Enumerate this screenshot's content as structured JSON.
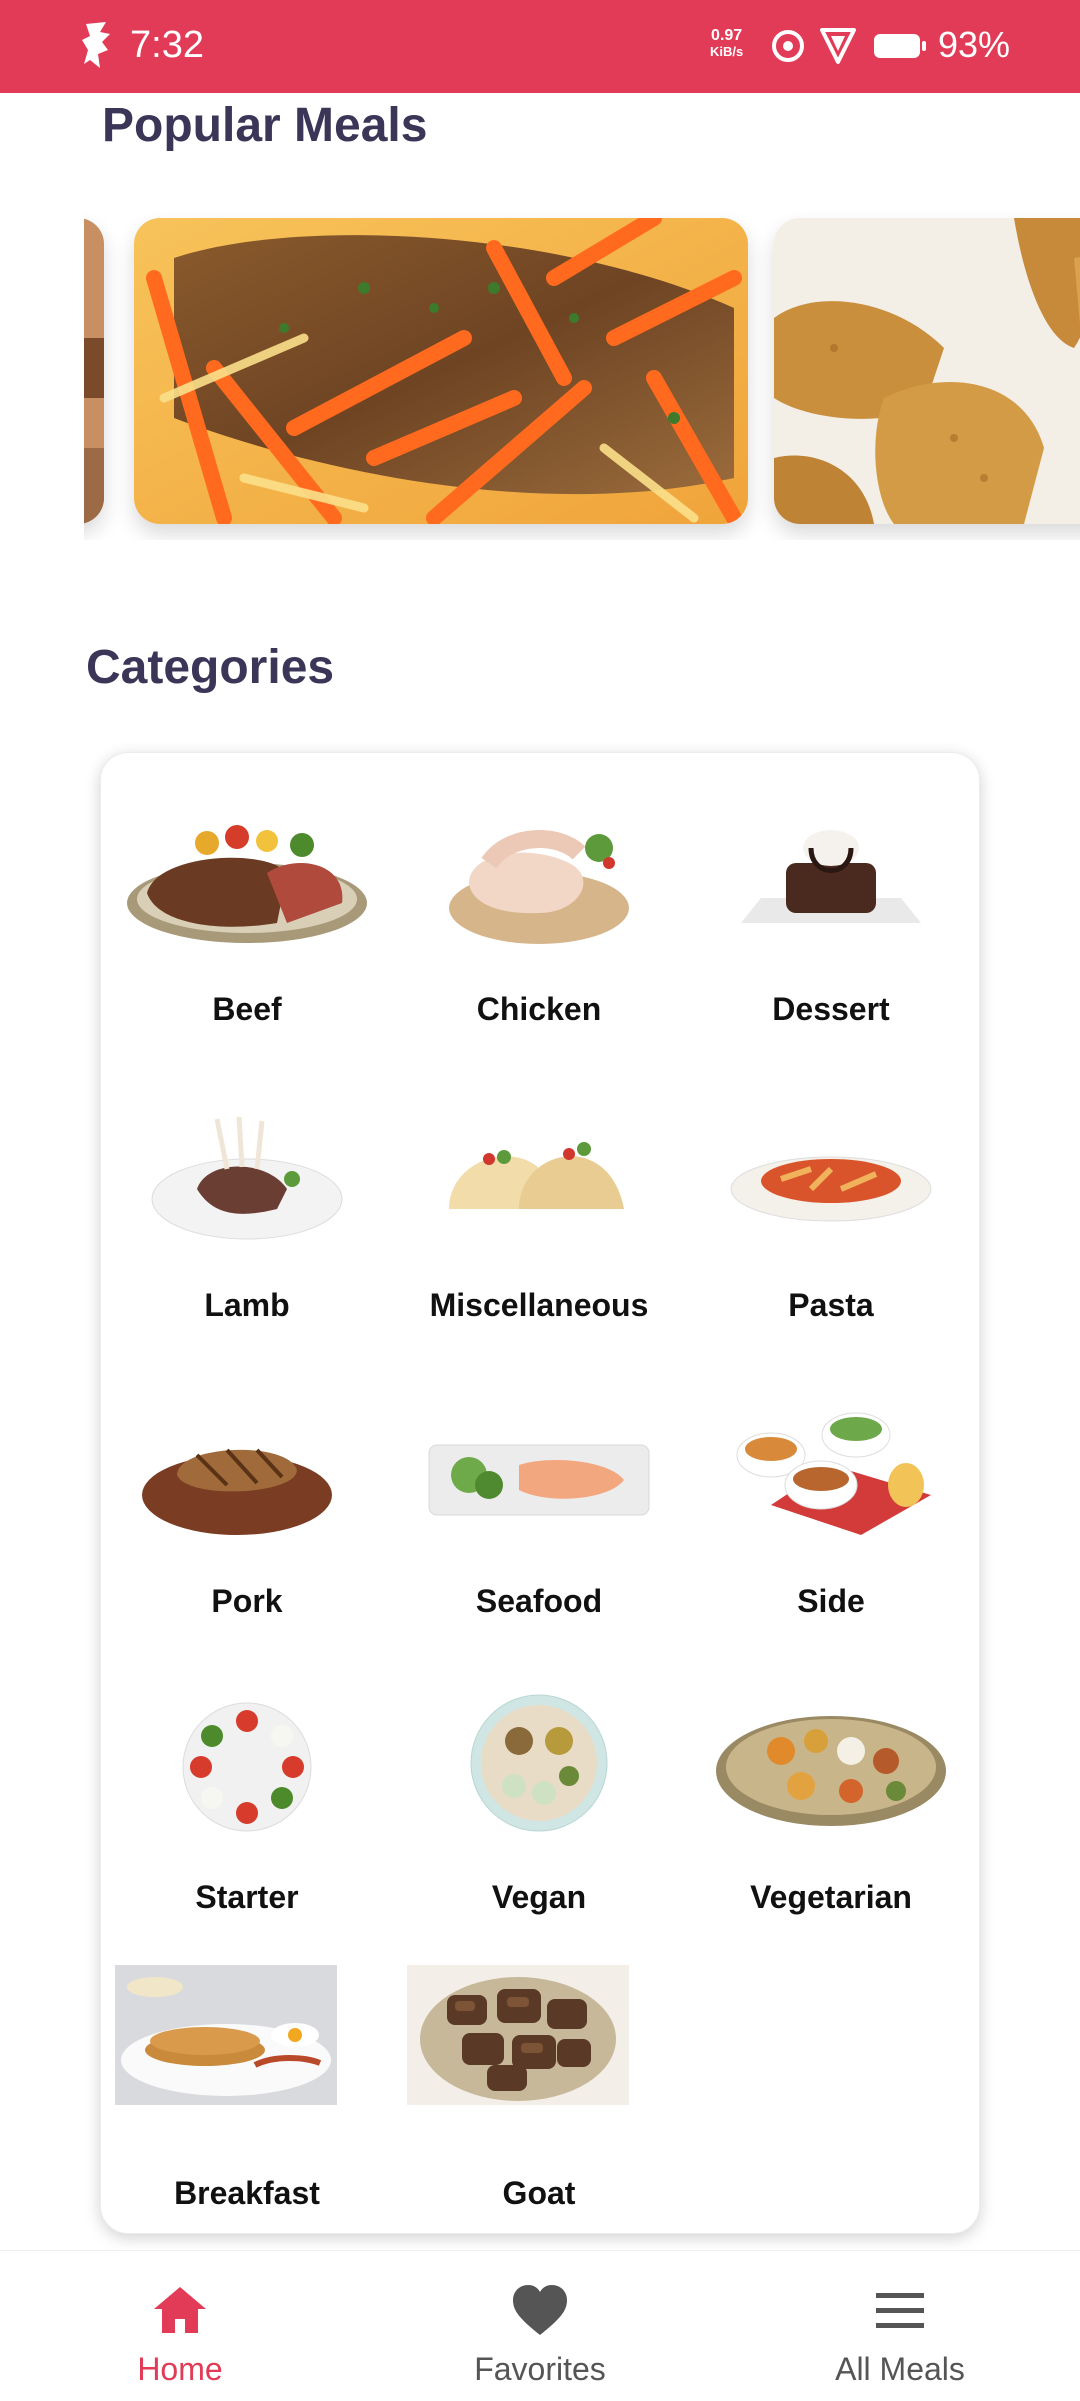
{
  "status_bar": {
    "time": "7:32",
    "speed_value": "0.97",
    "speed_unit": "KiB/s",
    "battery": "93%",
    "icons": [
      "app-logo-icon",
      "data-saver-icon",
      "vpn-icon",
      "battery-icon"
    ]
  },
  "popular": {
    "title": "Popular Meals"
  },
  "categories": {
    "title": "Categories",
    "items": [
      {
        "label": "Beef"
      },
      {
        "label": "Chicken"
      },
      {
        "label": "Dessert"
      },
      {
        "label": "Lamb"
      },
      {
        "label": "Miscellaneous"
      },
      {
        "label": "Pasta"
      },
      {
        "label": "Pork"
      },
      {
        "label": "Seafood"
      },
      {
        "label": "Side"
      },
      {
        "label": "Starter"
      },
      {
        "label": "Vegan"
      },
      {
        "label": "Vegetarian"
      },
      {
        "label": "Breakfast"
      },
      {
        "label": "Goat"
      }
    ]
  },
  "bottom_nav": {
    "items": [
      {
        "label": "Home",
        "icon": "home-icon",
        "active": true
      },
      {
        "label": "Favorites",
        "icon": "heart-icon",
        "active": false
      },
      {
        "label": "All Meals",
        "icon": "menu-icon",
        "active": false
      }
    ]
  },
  "colors": {
    "accent": "#e23b57",
    "title": "#3b3558"
  }
}
